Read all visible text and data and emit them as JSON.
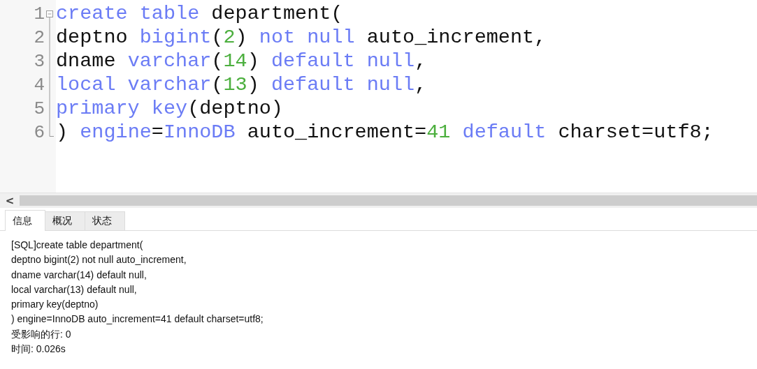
{
  "editor": {
    "fold_expanded": true,
    "lines": [
      {
        "number": "1",
        "tokens": [
          {
            "kind": "keyword",
            "text": "create table"
          },
          {
            "kind": "plain",
            "text": " department("
          }
        ]
      },
      {
        "number": "2",
        "tokens": [
          {
            "kind": "plain",
            "text": "deptno "
          },
          {
            "kind": "keyword",
            "text": "bigint"
          },
          {
            "kind": "plain",
            "text": "("
          },
          {
            "kind": "number",
            "text": "2"
          },
          {
            "kind": "plain",
            "text": ") "
          },
          {
            "kind": "keyword",
            "text": "not null"
          },
          {
            "kind": "plain",
            "text": " auto_increment,"
          }
        ]
      },
      {
        "number": "3",
        "tokens": [
          {
            "kind": "plain",
            "text": "dname "
          },
          {
            "kind": "keyword",
            "text": "varchar"
          },
          {
            "kind": "plain",
            "text": "("
          },
          {
            "kind": "number",
            "text": "14"
          },
          {
            "kind": "plain",
            "text": ") "
          },
          {
            "kind": "keyword",
            "text": "default null"
          },
          {
            "kind": "plain",
            "text": ","
          }
        ]
      },
      {
        "number": "4",
        "tokens": [
          {
            "kind": "keyword",
            "text": "local varchar"
          },
          {
            "kind": "plain",
            "text": "("
          },
          {
            "kind": "number",
            "text": "13"
          },
          {
            "kind": "plain",
            "text": ") "
          },
          {
            "kind": "keyword",
            "text": "default null"
          },
          {
            "kind": "plain",
            "text": ","
          }
        ]
      },
      {
        "number": "5",
        "tokens": [
          {
            "kind": "keyword",
            "text": "primary key"
          },
          {
            "kind": "plain",
            "text": "(deptno)"
          }
        ]
      },
      {
        "number": "6",
        "tokens": [
          {
            "kind": "plain",
            "text": ") "
          },
          {
            "kind": "keyword",
            "text": "engine"
          },
          {
            "kind": "plain",
            "text": "="
          },
          {
            "kind": "keyword",
            "text": "InnoDB"
          },
          {
            "kind": "plain",
            "text": " auto_increment="
          },
          {
            "kind": "number",
            "text": "41"
          },
          {
            "kind": "keyword",
            "text": " default"
          },
          {
            "kind": "plain",
            "text": " charset=utf8;"
          }
        ]
      }
    ]
  },
  "scrollbar": {
    "arrow": "<"
  },
  "tabs": [
    {
      "label": "信息",
      "selected": true
    },
    {
      "label": "概况",
      "selected": false
    },
    {
      "label": "状态",
      "selected": false
    }
  ],
  "messages": [
    "[SQL]create table department(",
    "deptno bigint(2) not null auto_increment,",
    "dname varchar(14) default null,",
    "local varchar(13) default null,",
    "primary key(deptno)",
    ") engine=InnoDB auto_increment=41 default charset=utf8;",
    "受影响的行: 0",
    "时间: 0.026s"
  ]
}
